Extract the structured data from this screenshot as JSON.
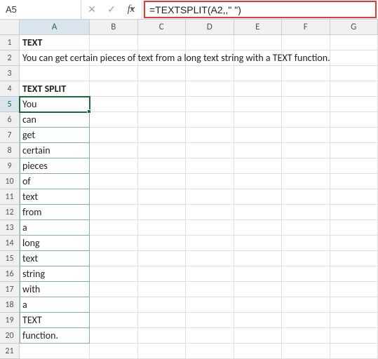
{
  "nameBox": {
    "value": "A5"
  },
  "formulaBar": {
    "cancel_glyph": "✕",
    "enter_glyph": "✓",
    "fx_glyph": "fx",
    "value": "=TEXTSPLIT(A2,,\" \")"
  },
  "columns": [
    "A",
    "B",
    "C",
    "D",
    "E",
    "F",
    "G"
  ],
  "cells": {
    "A1": "TEXT",
    "A2": "You can get certain pieces of text from a long text string with a TEXT function.",
    "A4": "TEXT SPLIT",
    "A5": "You",
    "A6": "can",
    "A7": "get",
    "A8": "certain",
    "A9": "pieces",
    "A10": "of",
    "A11": "text",
    "A12": "from",
    "A13": "a",
    "A14": "long",
    "A15": "text",
    "A16": "string",
    "A17": "with",
    "A18": "a",
    "A19": "TEXT",
    "A20": "function."
  },
  "rowsVisible": 21,
  "activeCell": "A5",
  "spillRange": {
    "startRow": 5,
    "endRow": 20,
    "col": "A"
  },
  "boldCells": [
    "A1",
    "A4"
  ],
  "chart_data": null
}
